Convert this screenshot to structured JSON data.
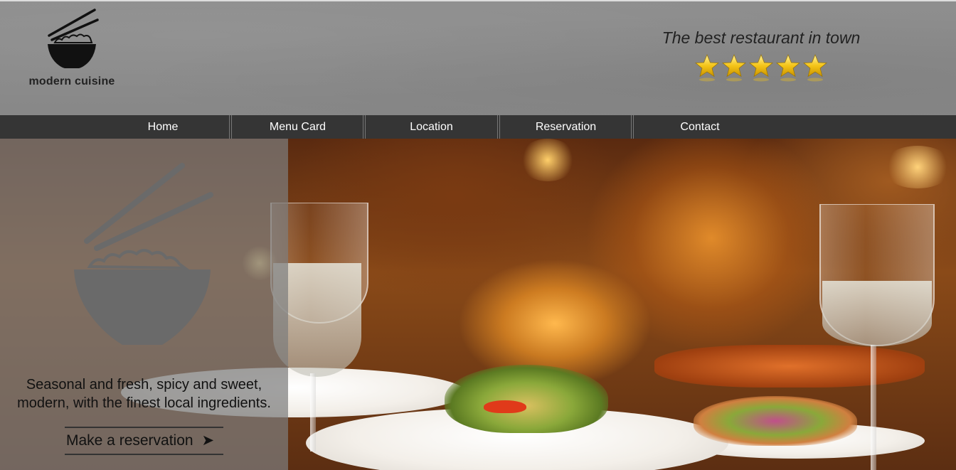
{
  "brand": {
    "name": "modern cuisine",
    "logo_icon": "rice-bowl-chopsticks-icon"
  },
  "header": {
    "tagline": "The best restaurant in town",
    "rating": {
      "stars": 5,
      "max": 5,
      "icon": "star-icon",
      "color": "#f5c518"
    }
  },
  "nav": {
    "items": [
      {
        "label": "Home"
      },
      {
        "label": "Menu Card"
      },
      {
        "label": "Location"
      },
      {
        "label": "Reservation"
      },
      {
        "label": "Contact"
      }
    ]
  },
  "hero": {
    "icon": "rice-bowl-chopsticks-icon",
    "text_line1": "Seasonal and fresh, spicy and sweet,",
    "text_line2": "modern, with the finest local ingredients.",
    "cta_label": "Make a reservation",
    "cta_icon": "arrow-right-icon"
  },
  "colors": {
    "header_bg": "#8c8c8c",
    "nav_bg": "#353535",
    "overlay": "#7d7d7d",
    "text_dark": "#222222"
  }
}
